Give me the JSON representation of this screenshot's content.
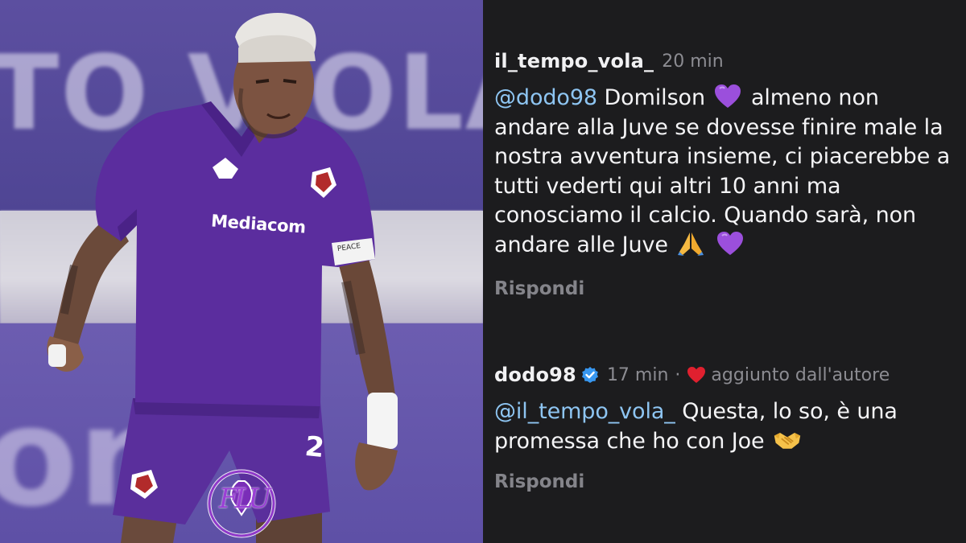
{
  "photo": {
    "banner_top_text": "TO VIOLA CLUB",
    "banner_bottom_text": "on",
    "sponsor": "Mediacom",
    "armband": "PEACE",
    "kit_number": "2",
    "watermark": "FLU",
    "colors": {
      "kit": "#5b2d9e",
      "banner": "#5a4d9f"
    }
  },
  "comments": [
    {
      "username": "il_tempo_vola_",
      "time": "20 min",
      "mention": "@dodo98",
      "text_parts": [
        "Domilson",
        "almeno non andare alla Juve se dovesse finire male la nostra avventura insieme, ci piacerebbe a tutti vederti qui altri 10 anni ma conosciamo il calcio. Quando sarà, non andare alle Juve"
      ],
      "emojis": [
        "purple-heart",
        "folded-hands",
        "purple-heart"
      ],
      "reply_label": "Rispondi"
    },
    {
      "username": "dodo98",
      "verified": true,
      "time": "17 min",
      "separator": "·",
      "liked_by_author": "aggiunto dall'autore",
      "mention": "@il_tempo_vola_",
      "text": "Questa, lo so, è una promessa che ho con Joe",
      "emojis": [
        "handshake"
      ],
      "reply_label": "Rispondi"
    }
  ],
  "colors": {
    "background": "#1c1c1e",
    "username": "#f1f1f3",
    "meta": "#8c8c92",
    "mention": "#8ec5f2",
    "heart": "#e0202f",
    "verified": "#3897f0"
  }
}
